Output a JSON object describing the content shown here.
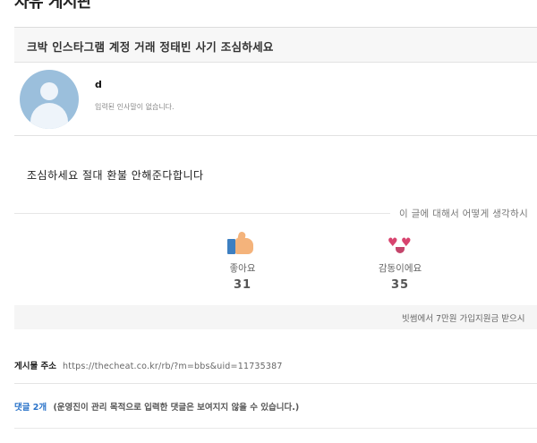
{
  "board": {
    "title": "자유 게시판"
  },
  "post": {
    "title": "크박 인스타그램 계정 거래 정태빈 사기 조심하세요",
    "author": "d",
    "author_intro": "입력된 인사말이 없습니다.",
    "body": "조심하세요 절대 환불 안해준다합니다"
  },
  "reactions": {
    "question": "이 글에 대해서 어떻게 생각하시",
    "like": {
      "label": "좋아요",
      "count": "31",
      "icon": "thumbs-up-icon"
    },
    "touched": {
      "label": "감동이에요",
      "count": "35",
      "icon": "heart-eyes-icon"
    }
  },
  "info_bar": {
    "text": "빗썸에서 7만원 가입지원금 받으시"
  },
  "address": {
    "label": "게시물 주소",
    "url": "https://thecheat.co.kr/rb/?m=bbs&uid=11735387"
  },
  "comments": {
    "count_label": "댓글 2개",
    "note": "(운영진이 관리 목적으로 입력한 댓글은 보여지지 않을 수 있습니다.)"
  },
  "colors": {
    "accent_blue": "#2a73c9",
    "avatar_bg": "#9bbfdc"
  }
}
